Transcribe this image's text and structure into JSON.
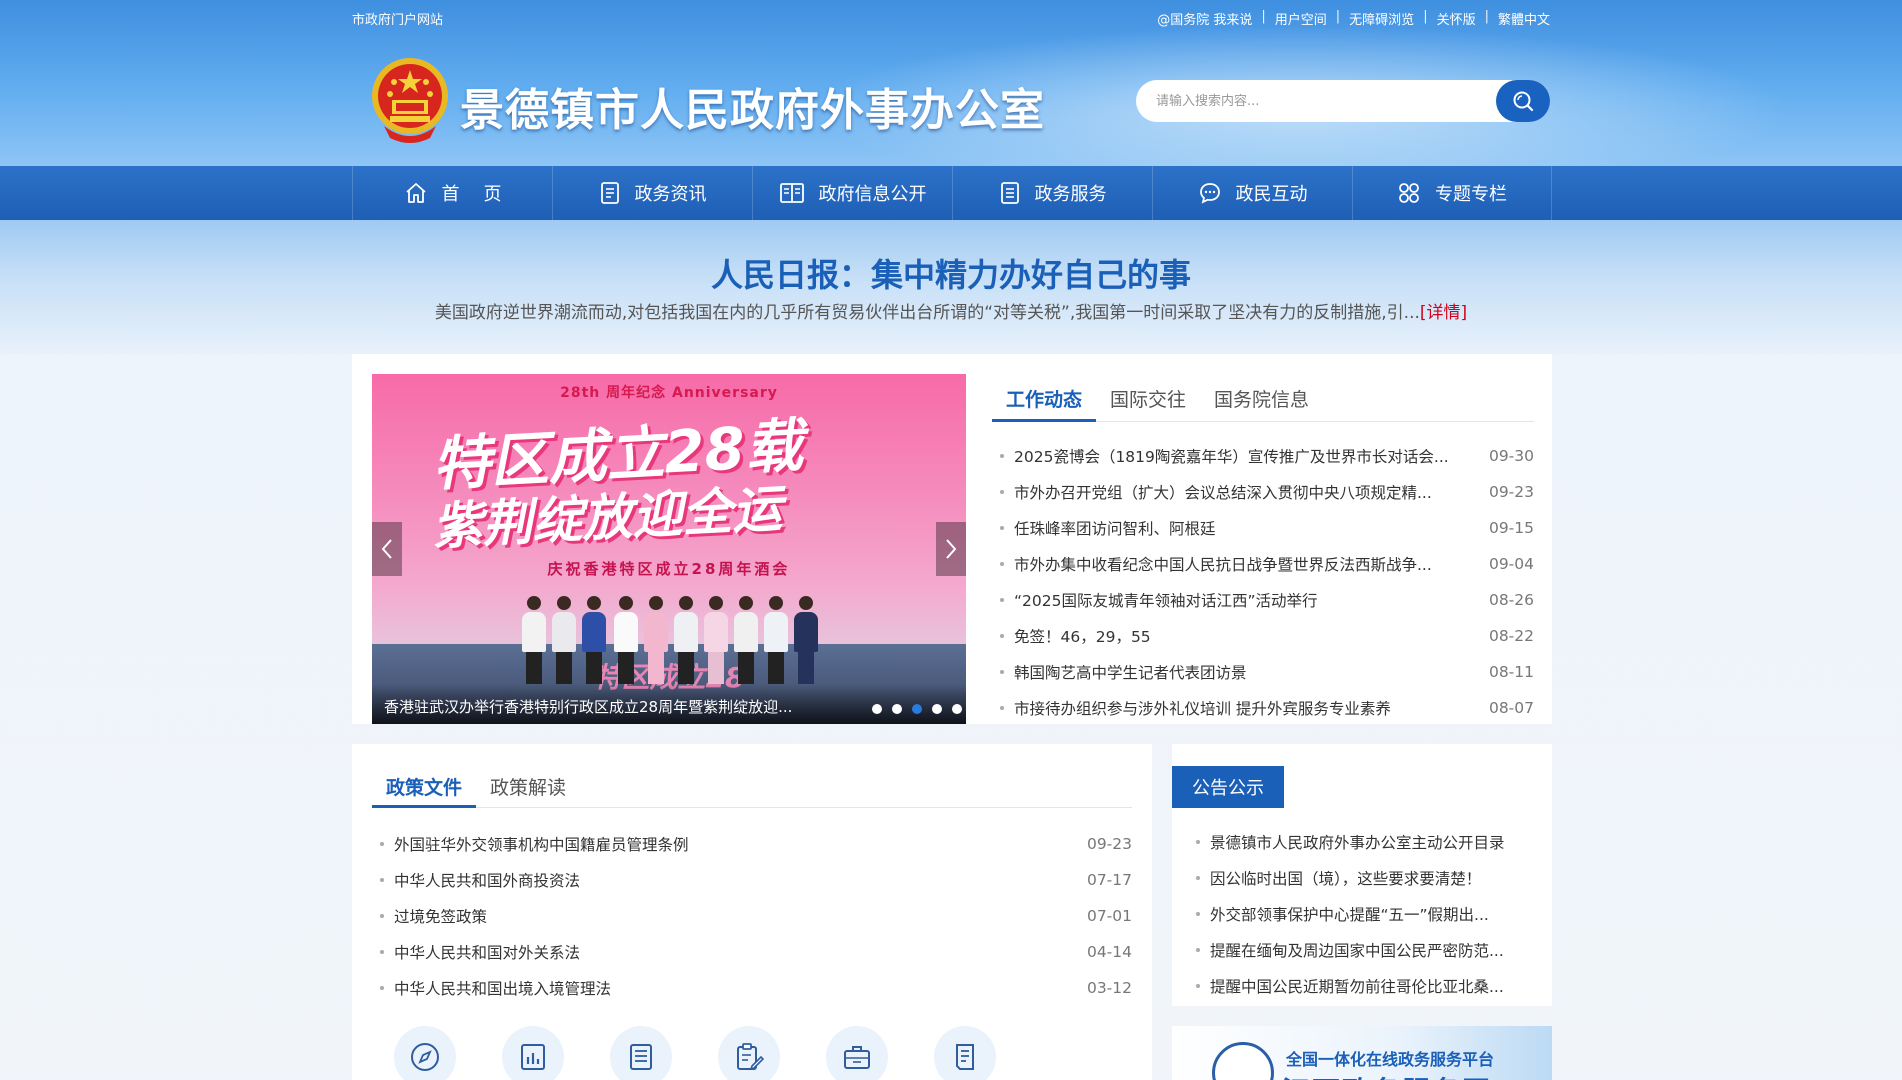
{
  "topbar": {
    "portal": "市政府门户网站",
    "links": [
      "@国务院 我来说",
      "用户空间",
      "无障碍浏览",
      "关怀版",
      "繁體中文"
    ]
  },
  "site": {
    "title": "景德镇市人民政府外事办公室"
  },
  "search": {
    "placeholder": "请输入搜索内容..."
  },
  "nav": [
    {
      "label": "首页",
      "icon": "home-icon"
    },
    {
      "label": "政务资讯",
      "icon": "document-icon"
    },
    {
      "label": "政府信息公开",
      "icon": "book-icon"
    },
    {
      "label": "政务服务",
      "icon": "list-icon"
    },
    {
      "label": "政民互动",
      "icon": "chat-icon"
    },
    {
      "label": "专题专栏",
      "icon": "apps-icon"
    }
  ],
  "headline": {
    "title": "人民日报：集中精力办好自己的事",
    "desc": "美国政府逆世界潮流而动,对包括我国在内的几乎所有贸易伙伴出台所谓的“对等关税”,我国第一时间采取了坚决有力的反制措施,引...",
    "more": "[详情]"
  },
  "slider": {
    "banner_sub": "28th 周年纪念 Anniversary",
    "banner_line1": "特区成立28载",
    "banner_line2": "紫荆绽放迎全运",
    "banner_line3": "庆祝香港特区成立28周年酒会",
    "stage_text": "特区成立28",
    "caption": "香港驻武汉办举行香港特别行政区成立28周年暨紫荆绽放迎...",
    "dots": 5,
    "active_dot": 2
  },
  "news_tabs": [
    "工作动态",
    "国际交往",
    "国务院信息"
  ],
  "news": [
    {
      "title": "2025瓷博会（1819陶瓷嘉年华）宣传推广及世界市长对话会...",
      "date": "09-30"
    },
    {
      "title": "市外办召开党组（扩大）会议总结深入贯彻中央八项规定精...",
      "date": "09-23"
    },
    {
      "title": "任珠峰率团访问智利、阿根廷",
      "date": "09-15"
    },
    {
      "title": "市外办集中收看纪念中国人民抗日战争暨世界反法西斯战争...",
      "date": "09-04"
    },
    {
      "title": "“2025国际友城青年领袖对话江西”活动举行",
      "date": "08-26"
    },
    {
      "title": "免签！46，29，55",
      "date": "08-22"
    },
    {
      "title": "韩国陶艺高中学生记者代表团访景",
      "date": "08-11"
    },
    {
      "title": "市接待办组织参与涉外礼仪培训 提升外宾服务专业素养",
      "date": "08-07"
    }
  ],
  "policy_tabs": [
    "政策文件",
    "政策解读"
  ],
  "policy": [
    {
      "title": "外国驻华外交领事机构中国籍雇员管理条例",
      "date": "09-23"
    },
    {
      "title": "中华人民共和国外商投资法",
      "date": "07-17"
    },
    {
      "title": "过境免签政策",
      "date": "07-01"
    },
    {
      "title": "中华人民共和国对外关系法",
      "date": "04-14"
    },
    {
      "title": "中华人民共和国出境入境管理法",
      "date": "03-12"
    }
  ],
  "service_icons": [
    "compass-icon",
    "chart-icon",
    "list-icon",
    "clipboard-edit-icon",
    "briefcase-icon",
    "document-icon"
  ],
  "notice": {
    "tab": "公告公示",
    "items": [
      "景德镇市人民政府外事办公室主动公开目录",
      "因公临时出国（境），这些要求要清楚！",
      "外交部领事保护中心提醒“五一”假期出...",
      "提醒在缅甸及周边国家中国公民严密防范...",
      "提醒中国公民近期暂勿前往哥伦比亚北桑..."
    ]
  },
  "banner": {
    "line1": "全国一体化在线政务服务平台",
    "line2": "江西政务服务网"
  },
  "colors": {
    "brand": "#1a5fb8",
    "accent_red": "#d0021b",
    "nav_bg": "#2368bd"
  }
}
